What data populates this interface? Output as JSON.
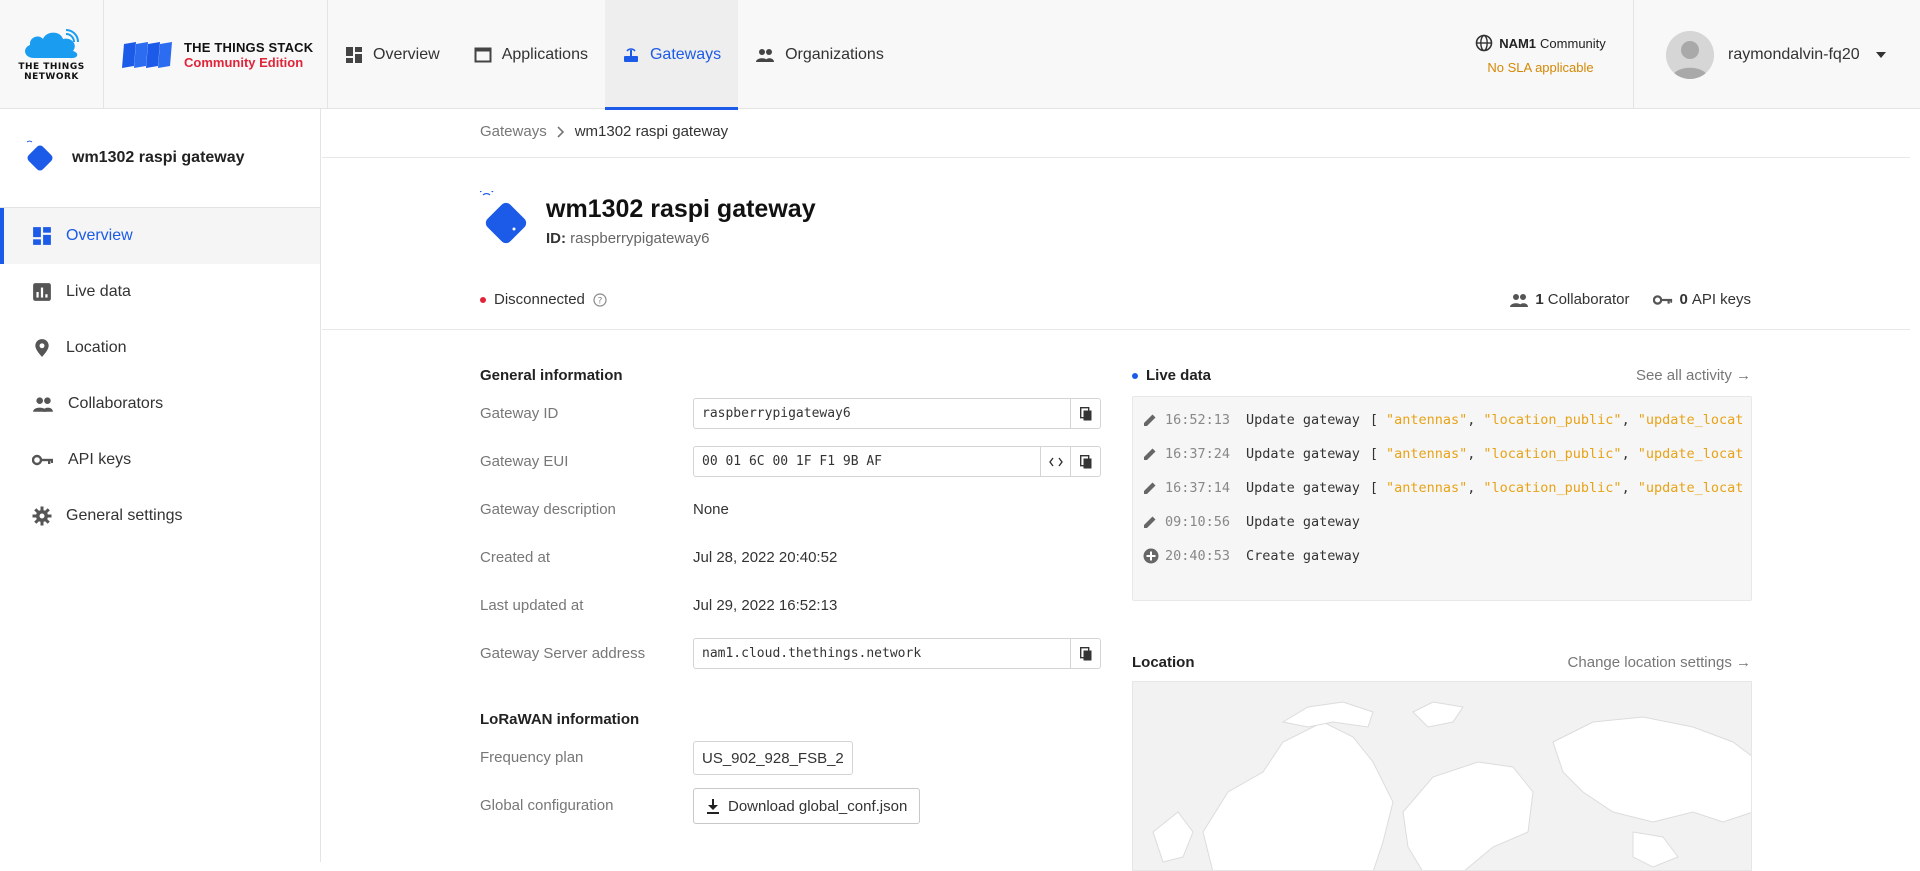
{
  "header": {
    "ttn_logo_text": "THE THINGS NETWORK",
    "tts_title": "THE THINGS STACK",
    "tts_subtitle": "Community Edition",
    "nav": [
      {
        "label": "Overview",
        "icon": "dashboard-icon",
        "active": false
      },
      {
        "label": "Applications",
        "icon": "window-icon",
        "active": false
      },
      {
        "label": "Gateways",
        "icon": "gateway-icon",
        "active": true
      },
      {
        "label": "Organizations",
        "icon": "group-icon",
        "active": false
      }
    ],
    "cluster_name": "NAM1",
    "cluster_suffix": "Community",
    "cluster_note": "No SLA applicable",
    "username": "raymondalvin-fq20"
  },
  "sidebar": {
    "title": "wm1302 raspi gateway",
    "items": [
      {
        "label": "Overview",
        "icon": "dashboard-icon",
        "active": true
      },
      {
        "label": "Live data",
        "icon": "bar-chart-icon",
        "active": false
      },
      {
        "label": "Location",
        "icon": "location-pin-icon",
        "active": false
      },
      {
        "label": "Collaborators",
        "icon": "people-icon",
        "active": false
      },
      {
        "label": "API keys",
        "icon": "key-icon",
        "active": false
      },
      {
        "label": "General settings",
        "icon": "gear-icon",
        "active": false
      }
    ]
  },
  "breadcrumb": {
    "root": "Gateways",
    "current": "wm1302 raspi gateway"
  },
  "gateway": {
    "title": "wm1302 raspi gateway",
    "id_label": "ID:",
    "id_value": "raspberrypigateway6",
    "status": "Disconnected",
    "collaborators_count": "1",
    "collaborators_label": "Collaborator",
    "api_keys_count": "0",
    "api_keys_label": "API keys"
  },
  "general": {
    "title": "General information",
    "gateway_id_label": "Gateway ID",
    "gateway_id": "raspberrypigateway6",
    "eui_label": "Gateway EUI",
    "eui": "00 01 6C 00 1F F1 9B AF",
    "description_label": "Gateway description",
    "description": "None",
    "created_label": "Created at",
    "created": "Jul 28, 2022 20:40:52",
    "updated_label": "Last updated at",
    "updated": "Jul 29, 2022 16:52:13",
    "server_label": "Gateway Server address",
    "server": "nam1.cloud.thethings.network"
  },
  "lorawan": {
    "title": "LoRaWAN information",
    "freq_label": "Frequency plan",
    "freq": "US_902_928_FSB_2",
    "global_label": "Global configuration",
    "download_label": "Download global_conf.json"
  },
  "live": {
    "title": "Live data",
    "see_all": "See all activity →",
    "events": [
      {
        "icon": "pencil-icon",
        "time": "16:52:13",
        "msg": "Update gateway",
        "fields": [
          "\"antennas\"",
          "\"location_public\"",
          "\"update_locat"
        ]
      },
      {
        "icon": "pencil-icon",
        "time": "16:37:24",
        "msg": "Update gateway",
        "fields": [
          "\"antennas\"",
          "\"location_public\"",
          "\"update_locat"
        ]
      },
      {
        "icon": "pencil-icon",
        "time": "16:37:14",
        "msg": "Update gateway",
        "fields": [
          "\"antennas\"",
          "\"location_public\"",
          "\"update_locat"
        ]
      },
      {
        "icon": "pencil-icon",
        "time": "09:10:56",
        "msg": "Update gateway",
        "fields": []
      },
      {
        "icon": "plus-circle-icon",
        "time": "20:40:53",
        "msg": "Create gateway",
        "fields": []
      }
    ]
  },
  "location": {
    "title": "Location",
    "change_link": "Change location settings →"
  },
  "colors": {
    "accent": "#1c5ae8",
    "error": "#e0243a",
    "warning": "#d48806",
    "json_string": "#e8a317"
  }
}
